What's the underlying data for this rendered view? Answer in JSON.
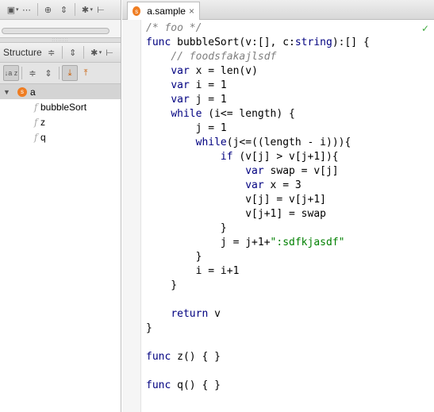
{
  "structure_panel": {
    "title": "Structure"
  },
  "editor": {
    "tab_label": "a.sample",
    "tab_close_icon": "×",
    "file_icon_glyph": "s",
    "status_ok": "✓"
  },
  "tree": {
    "root": "a",
    "children": [
      {
        "label": "bubbleSort",
        "icon": "f"
      },
      {
        "label": "z",
        "icon": "f"
      },
      {
        "label": "q",
        "icon": "f"
      }
    ]
  },
  "icons": {
    "tree_expanded": "▼",
    "gear": "✱",
    "caret": "▾",
    "pin": "⊢",
    "target": "⊕",
    "collapse_all": "⇕",
    "expand_collapse": "≑",
    "sort_alpha": "↓a z",
    "autoscroll_to": "⤓",
    "autoscroll_from": "⤒"
  },
  "colors": {
    "keyword": "#000080",
    "comment": "#808080",
    "string": "#008000",
    "file_badge": "#ef7d22",
    "ok_check": "#3faa3f"
  },
  "code_lines": [
    [
      {
        "t": "/* foo */",
        "c": "cm"
      }
    ],
    [
      {
        "t": "func",
        "c": "kw"
      },
      {
        "t": " bubbleSort(v:[], c:",
        "c": "id"
      },
      {
        "t": "string",
        "c": "kw"
      },
      {
        "t": "):[] {",
        "c": "id"
      }
    ],
    [
      {
        "t": "    ",
        "c": "id"
      },
      {
        "t": "// foodsfakajlsdf",
        "c": "cm"
      }
    ],
    [
      {
        "t": "    ",
        "c": "id"
      },
      {
        "t": "var",
        "c": "kw"
      },
      {
        "t": " x = len(v)",
        "c": "id"
      }
    ],
    [
      {
        "t": "    ",
        "c": "id"
      },
      {
        "t": "var",
        "c": "kw"
      },
      {
        "t": " i = 1",
        "c": "id"
      }
    ],
    [
      {
        "t": "    ",
        "c": "id"
      },
      {
        "t": "var",
        "c": "kw"
      },
      {
        "t": " j = 1",
        "c": "id"
      }
    ],
    [
      {
        "t": "    ",
        "c": "id"
      },
      {
        "t": "while",
        "c": "kw"
      },
      {
        "t": " (i<= length) {",
        "c": "id"
      }
    ],
    [
      {
        "t": "        j = 1",
        "c": "id"
      }
    ],
    [
      {
        "t": "        ",
        "c": "id"
      },
      {
        "t": "while",
        "c": "kw"
      },
      {
        "t": "(j<=((length - i))){",
        "c": "id"
      }
    ],
    [
      {
        "t": "            ",
        "c": "id"
      },
      {
        "t": "if",
        "c": "kw"
      },
      {
        "t": " (v[j] > v[j+1]){",
        "c": "id"
      }
    ],
    [
      {
        "t": "                ",
        "c": "id"
      },
      {
        "t": "var",
        "c": "kw"
      },
      {
        "t": " swap = v[j]",
        "c": "id"
      }
    ],
    [
      {
        "t": "                ",
        "c": "id"
      },
      {
        "t": "var",
        "c": "kw"
      },
      {
        "t": " x = 3",
        "c": "id"
      }
    ],
    [
      {
        "t": "                v[j] = v[j+1]",
        "c": "id"
      }
    ],
    [
      {
        "t": "                v[j+1] = swap",
        "c": "id"
      }
    ],
    [
      {
        "t": "            }",
        "c": "id"
      }
    ],
    [
      {
        "t": "            j = j+1+",
        "c": "id"
      },
      {
        "t": "\":sdfkjasdf\"",
        "c": "str"
      }
    ],
    [
      {
        "t": "        }",
        "c": "id"
      }
    ],
    [
      {
        "t": "        i = i+1",
        "c": "id"
      }
    ],
    [
      {
        "t": "    }",
        "c": "id"
      }
    ],
    [
      {
        "t": "",
        "c": "id"
      }
    ],
    [
      {
        "t": "    ",
        "c": "id"
      },
      {
        "t": "return",
        "c": "kw"
      },
      {
        "t": " v",
        "c": "id"
      }
    ],
    [
      {
        "t": "}",
        "c": "id"
      }
    ],
    [
      {
        "t": "",
        "c": "id"
      }
    ],
    [
      {
        "t": "func",
        "c": "kw"
      },
      {
        "t": " z() { }",
        "c": "id"
      }
    ],
    [
      {
        "t": "",
        "c": "id"
      }
    ],
    [
      {
        "t": "func",
        "c": "kw"
      },
      {
        "t": " q() { }",
        "c": "id"
      }
    ]
  ]
}
